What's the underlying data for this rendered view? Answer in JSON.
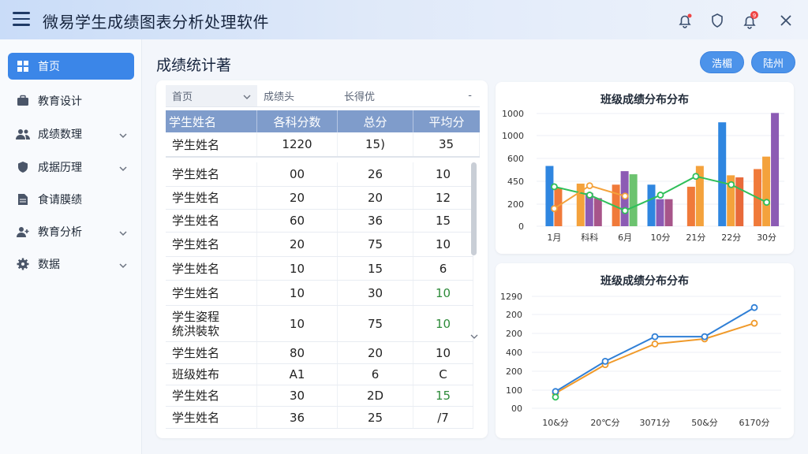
{
  "app": {
    "title": "微易学生成绩图表分析处理软件"
  },
  "titlebar_icons": [
    "menu-icon",
    "alert-bell-icon",
    "shield-icon",
    "notification-bell-icon",
    "close-icon"
  ],
  "notification_badge": "9",
  "sidebar": {
    "items": [
      {
        "label": "首页",
        "icon": "grid-icon",
        "active": true
      },
      {
        "label": "教育设计",
        "icon": "briefcase-icon"
      },
      {
        "label": "成绩数理",
        "icon": "users-icon",
        "expandable": true
      },
      {
        "label": "成据历理",
        "icon": "shield-icon",
        "expandable": true
      },
      {
        "label": "食请膜绩",
        "icon": "document-icon"
      },
      {
        "label": "教育分析",
        "icon": "user-plus-icon",
        "expandable": true
      },
      {
        "label": "数据",
        "icon": "gear-icon",
        "expandable": true
      }
    ]
  },
  "page": {
    "title": "成绩统计著"
  },
  "actions": {
    "btn1": "浩楣",
    "btn2": "陆州"
  },
  "table": {
    "filters": [
      "首页",
      "成绩头",
      "长得优",
      "-"
    ],
    "headers": [
      "学生姓名",
      "各科分数",
      "总分",
      "平均分"
    ],
    "summary_row": [
      "学生姓名",
      "1220",
      "15)",
      "35"
    ],
    "rows": [
      [
        "学生姓名",
        "00",
        "26",
        "10"
      ],
      [
        "学生姓名",
        "20",
        "20",
        "12"
      ],
      [
        "学生姓名",
        "60",
        "36",
        "15"
      ],
      [
        "学生姓名",
        "20",
        "75",
        "10"
      ],
      [
        "学生姓名",
        "10",
        "15",
        "6"
      ],
      [
        "学生姓名",
        "10",
        "30",
        "10"
      ],
      [
        "学生姿程\n统洪裝软",
        "10",
        "75",
        "10"
      ],
      [
        "学生姓名",
        "80",
        "20",
        "10"
      ],
      [
        "班级姓布",
        "A1",
        "6",
        "C"
      ],
      [
        "学生姓名",
        "30",
        "2D",
        "15"
      ],
      [
        "学生姓名",
        "36",
        "25",
        "/7"
      ]
    ],
    "green_cells": [
      [
        5,
        3
      ],
      [
        6,
        3
      ],
      [
        9,
        3
      ]
    ]
  },
  "chart_data": [
    {
      "type": "bar",
      "title": "班级成绩分布分布",
      "categories": [
        "1月",
        "科科",
        "6月",
        "10分",
        "21分",
        "22分",
        "30分"
      ],
      "y_tick_labels": [
        "0",
        "200",
        "450",
        "600",
        "1000",
        "1000"
      ],
      "series": [
        {
          "color": "#2f86e0",
          "values": [
            580,
            0,
            0,
            400,
            0,
            1000,
            0
          ]
        },
        {
          "color": "#f07a3a",
          "values": [
            370,
            0,
            400,
            0,
            380,
            0,
            550
          ]
        },
        {
          "color": "#f4a23c",
          "values": [
            0,
            410,
            0,
            0,
            580,
            490,
            670
          ]
        },
        {
          "color": "#8c5bb4",
          "values": [
            0,
            320,
            530,
            260,
            0,
            0,
            1090
          ]
        },
        {
          "color": "#a7558a",
          "values": [
            0,
            270,
            0,
            260,
            0,
            0,
            0
          ]
        },
        {
          "color": "#e86a3a",
          "values": [
            0,
            0,
            0,
            0,
            0,
            470,
            0
          ]
        },
        {
          "color": "#6cc36f",
          "values": [
            0,
            0,
            500,
            0,
            0,
            0,
            0
          ]
        }
      ],
      "line_series": [
        {
          "color": "#2fbf5a",
          "values": [
            380,
            300,
            150,
            300,
            480,
            400,
            230
          ]
        },
        {
          "color": "#f4a23c",
          "values": [
            170,
            390,
            290,
            0,
            0,
            0,
            0
          ]
        }
      ]
    },
    {
      "type": "line",
      "title": "班级成绩分布分布",
      "x": [
        "10&分",
        "20℃分",
        "3071分",
        "50&分",
        "6170分"
      ],
      "y_tick_labels": [
        "00",
        "100",
        "200",
        "400",
        "200",
        "200",
        "1290"
      ],
      "series": [
        {
          "color": "#2f7fd6",
          "values": [
            150,
            420,
            640,
            640,
            900
          ]
        },
        {
          "color": "#f09a2a",
          "values": [
            135,
            390,
            575,
            620,
            760
          ]
        }
      ]
    }
  ]
}
